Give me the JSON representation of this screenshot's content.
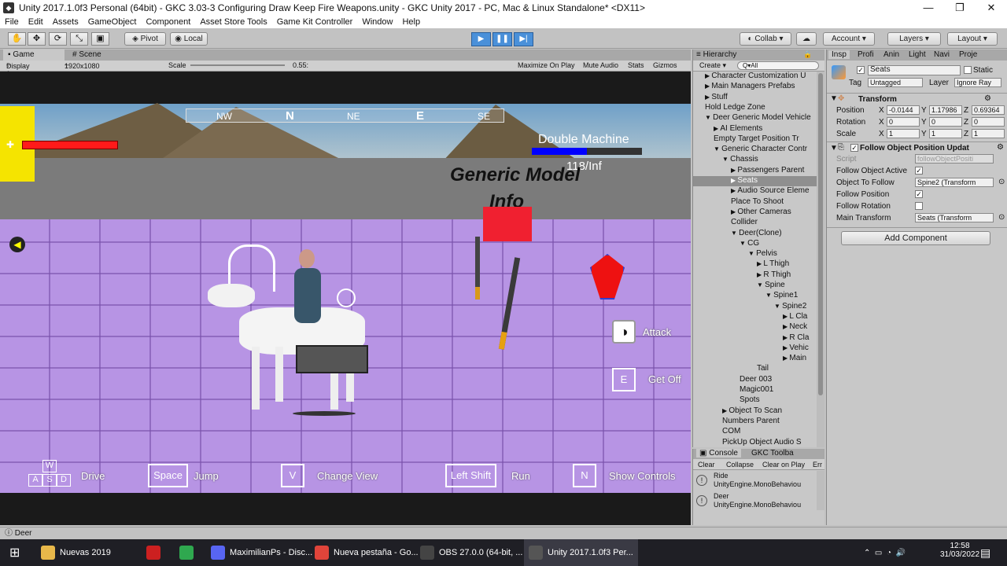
{
  "window": {
    "title": "Unity 2017.1.0f3 Personal (64bit) - GKC 3.03-3 Configuring Draw Keep Fire Weapons.unity - GKC Unity 2017 - PC, Mac & Linux Standalone* <DX11>",
    "min": "—",
    "max": "❐",
    "close": "✕"
  },
  "menu": [
    "File",
    "Edit",
    "Assets",
    "GameObject",
    "Component",
    "Asset Store Tools",
    "Game Kit Controller",
    "Window",
    "Help"
  ],
  "toolbar": {
    "pivot": "Pivot",
    "local": "Local",
    "collab": "Collab",
    "account": "Account",
    "layers": "Layers",
    "layout": "Layout",
    "play": "▶",
    "pause": "❚❚",
    "step": "▶|"
  },
  "game": {
    "tab_game": "Game",
    "tab_scene": "Scene",
    "display": "Display 1",
    "resolution": "1920x1080",
    "scale_label": "Scale",
    "scale_value": "0.55:",
    "maximize": "Maximize On Play",
    "mute": "Mute Audio",
    "stats": "Stats",
    "gizmos": "Gizmos"
  },
  "hud": {
    "compass": [
      "NW",
      "N",
      "NE",
      "E",
      "SE"
    ],
    "weapon_name": "Double Machine",
    "ammo": "118/Inf",
    "sign_text_1": "Generic Model",
    "sign_text_2": "Info",
    "attack": "Attack",
    "getoff": "Get Off",
    "key_e": "E",
    "controls": [
      {
        "key": "W",
        "label": ""
      },
      {
        "key": "Space",
        "label": "Jump"
      },
      {
        "key": "V",
        "label": "Change View"
      },
      {
        "key": "Left Shift",
        "label": "Run"
      },
      {
        "key": "N",
        "label": "Show Controls"
      }
    ],
    "drive_keys": [
      "A",
      "S",
      "D"
    ],
    "drive": "Drive",
    "health_color": "#ff1a1a",
    "energy_color": "#0000ff",
    "floor_color": "#b794e4"
  },
  "hierarchy": {
    "title": "Hierarchy",
    "create": "Create",
    "search": "Q▾All",
    "rows": [
      {
        "d": 1,
        "a": "▶",
        "t": "Character Customization U"
      },
      {
        "d": 1,
        "a": "▶",
        "t": "Main Managers Prefabs"
      },
      {
        "d": 1,
        "a": "▶",
        "t": "Stuff"
      },
      {
        "d": 1,
        "a": "",
        "t": "Hold Ledge Zone"
      },
      {
        "d": 1,
        "a": "▼",
        "t": "Deer Generic Model Vehicle"
      },
      {
        "d": 2,
        "a": "▶",
        "t": "AI Elements"
      },
      {
        "d": 2,
        "a": "",
        "t": "Empty Target Position Tr"
      },
      {
        "d": 2,
        "a": "▼",
        "t": "Generic Character Contr"
      },
      {
        "d": 3,
        "a": "▼",
        "t": "Chassis"
      },
      {
        "d": 4,
        "a": "▶",
        "t": "Passengers Parent"
      },
      {
        "d": 4,
        "a": "▶",
        "t": "Seats",
        "sel": true
      },
      {
        "d": 4,
        "a": "▶",
        "t": "Audio Source Eleme"
      },
      {
        "d": 4,
        "a": "",
        "t": "Place To Shoot"
      },
      {
        "d": 4,
        "a": "▶",
        "t": "Other Cameras"
      },
      {
        "d": 4,
        "a": "",
        "t": "Collider"
      },
      {
        "d": 4,
        "a": "▼",
        "t": "Deer(Clone)"
      },
      {
        "d": 5,
        "a": "▼",
        "t": "CG"
      },
      {
        "d": 6,
        "a": "▼",
        "t": "Pelvis"
      },
      {
        "d": 7,
        "a": "▶",
        "t": "L Thigh"
      },
      {
        "d": 7,
        "a": "▶",
        "t": "R Thigh"
      },
      {
        "d": 7,
        "a": "▼",
        "t": "Spine"
      },
      {
        "d": 8,
        "a": "▼",
        "t": "Spine1"
      },
      {
        "d": 9,
        "a": "▼",
        "t": "Spine2"
      },
      {
        "d": 10,
        "a": "▶",
        "t": "L Cla"
      },
      {
        "d": 10,
        "a": "▶",
        "t": "Neck"
      },
      {
        "d": 10,
        "a": "▶",
        "t": "R Cla"
      },
      {
        "d": 10,
        "a": "▶",
        "t": "Vehic"
      },
      {
        "d": 10,
        "a": "▶",
        "t": "Main"
      },
      {
        "d": 7,
        "a": "",
        "t": "Tail"
      },
      {
        "d": 5,
        "a": "",
        "t": "Deer 003"
      },
      {
        "d": 5,
        "a": "",
        "t": "Magic001"
      },
      {
        "d": 5,
        "a": "",
        "t": "Spots"
      },
      {
        "d": 3,
        "a": "▶",
        "t": "Object To Scan"
      },
      {
        "d": 3,
        "a": "",
        "t": "Numbers Parent"
      },
      {
        "d": 3,
        "a": "",
        "t": "COM"
      },
      {
        "d": 3,
        "a": "",
        "t": "PickUp Object Audio S"
      }
    ]
  },
  "console": {
    "tab": "Console",
    "tab2": "GKC Toolba",
    "clear": "Clear",
    "collapse": "Collapse",
    "clear_on_play": "Clear on Play",
    "error": "Err",
    "msgs": [
      {
        "title": "Ride",
        "sub": "UnityEngine.MonoBehaviou"
      },
      {
        "title": "Deer",
        "sub": "UnityEngine.MonoBehaviou"
      }
    ]
  },
  "inspector": {
    "tabs": [
      "Insp",
      "Profi",
      "Anin",
      "Light",
      "Navi",
      "Proje"
    ],
    "object_name": "Seats",
    "static_label": "Static",
    "tag_label": "Tag",
    "tag_value": "Untagged",
    "layer_label": "Layer",
    "layer_value": "Ignore Ray",
    "transform": {
      "title": "Transform",
      "position_label": "Position",
      "rotation_label": "Rotation",
      "scale_label": "Scale",
      "position": [
        "-0.0144",
        "1.17986",
        "0.69364"
      ],
      "rotation": [
        "0",
        "0",
        "0"
      ],
      "scale": [
        "1",
        "1",
        "1"
      ],
      "x": "X",
      "y": "Y",
      "z": "Z"
    },
    "component": {
      "title": "Follow Object Position Updat",
      "script_label": "Script",
      "script_value": "followObjectPositi",
      "active_label": "Follow Object Active",
      "object_label": "Object To Follow",
      "object_value": "Spine2 (Transform",
      "pos_label": "Follow Position",
      "rot_label": "Follow Rotation",
      "main_label": "Main Transform",
      "main_value": "Seats (Transform"
    },
    "add_component": "Add Component"
  },
  "status": "Deer",
  "taskbar": {
    "items": [
      {
        "label": "Nuevas 2019",
        "color": "#e8b84a"
      },
      {
        "label": "",
        "color": "#cc2020"
      },
      {
        "label": "",
        "color": "#2fa84f"
      },
      {
        "label": "MaximilianPs - Disc...",
        "color": "#5865f2"
      },
      {
        "label": "Nueva pestaña - Go...",
        "color": "#e0443a"
      },
      {
        "label": "OBS 27.0.0 (64-bit, ...",
        "color": "#444"
      },
      {
        "label": "Unity 2017.1.0f3 Per...",
        "color": "#555"
      }
    ],
    "time": "12:58",
    "date": "31/03/2022"
  }
}
